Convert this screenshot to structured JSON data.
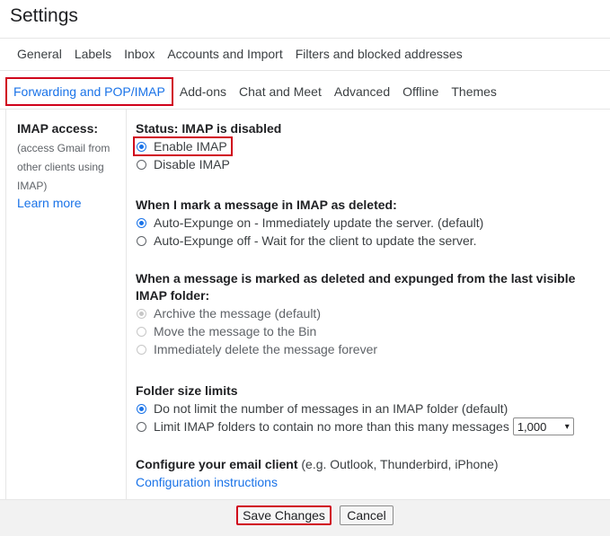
{
  "title": "Settings",
  "tabs_row1": [
    "General",
    "Labels",
    "Inbox",
    "Accounts and Import",
    "Filters and blocked addresses"
  ],
  "tabs_row2": {
    "active": "Forwarding and POP/IMAP",
    "others": [
      "Add-ons",
      "Chat and Meet",
      "Advanced",
      "Offline",
      "Themes"
    ]
  },
  "sidebar": {
    "label": "IMAP access:",
    "description": "(access Gmail from other clients using IMAP)",
    "learn_more": "Learn more"
  },
  "status": {
    "heading": "Status: IMAP is disabled",
    "options": [
      "Enable IMAP",
      "Disable IMAP"
    ],
    "selected": "Enable IMAP"
  },
  "deleted": {
    "heading": "When I mark a message in IMAP as deleted:",
    "options": [
      "Auto-Expunge on - Immediately update the server. (default)",
      "Auto-Expunge off - Wait for the client to update the server."
    ],
    "selected": "Auto-Expunge on - Immediately update the server. (default)"
  },
  "expunged": {
    "heading": "When a message is marked as deleted and expunged from the last visible IMAP folder:",
    "options": [
      "Archive the message (default)",
      "Move the message to the Bin",
      "Immediately delete the message forever"
    ],
    "selected": "Archive the message (default)",
    "disabled": true
  },
  "folder_size": {
    "heading": "Folder size limits",
    "options": [
      "Do not limit the number of messages in an IMAP folder (default)",
      "Limit IMAP folders to contain no more than this many messages"
    ],
    "selected": "Do not limit the number of messages in an IMAP folder (default)",
    "limit_value": "1,000"
  },
  "client": {
    "heading": "Configure your email client",
    "hint": "(e.g. Outlook, Thunderbird, iPhone)",
    "link": "Configuration instructions"
  },
  "buttons": {
    "save": "Save Changes",
    "cancel": "Cancel"
  },
  "colors": {
    "accent": "#1a73e8",
    "highlight_border": "#d0021b"
  }
}
